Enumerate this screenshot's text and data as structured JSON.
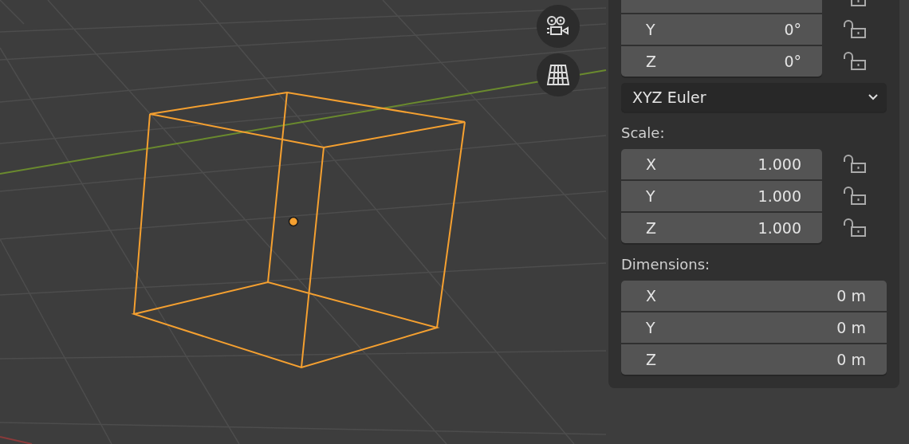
{
  "viewport": {
    "navigation_buttons": [
      {
        "kind": "camera"
      },
      {
        "kind": "grid"
      }
    ]
  },
  "rotation": {
    "fields": [
      {
        "locked": false
      },
      {
        "axis": "Y",
        "value": "0°",
        "locked": false
      },
      {
        "axis": "Z",
        "value": "0°",
        "locked": false
      }
    ],
    "mode": "XYZ Euler"
  },
  "scale": {
    "label": "Scale:",
    "fields": [
      {
        "axis": "X",
        "value": "1.000",
        "locked": false
      },
      {
        "axis": "Y",
        "value": "1.000",
        "locked": false
      },
      {
        "axis": "Z",
        "value": "1.000",
        "locked": false
      }
    ]
  },
  "dimensions": {
    "label": "Dimensions:",
    "fields": [
      {
        "axis": "X",
        "value": "0 m"
      },
      {
        "axis": "Y",
        "value": "0 m"
      },
      {
        "axis": "Z",
        "value": "0 m"
      }
    ]
  }
}
